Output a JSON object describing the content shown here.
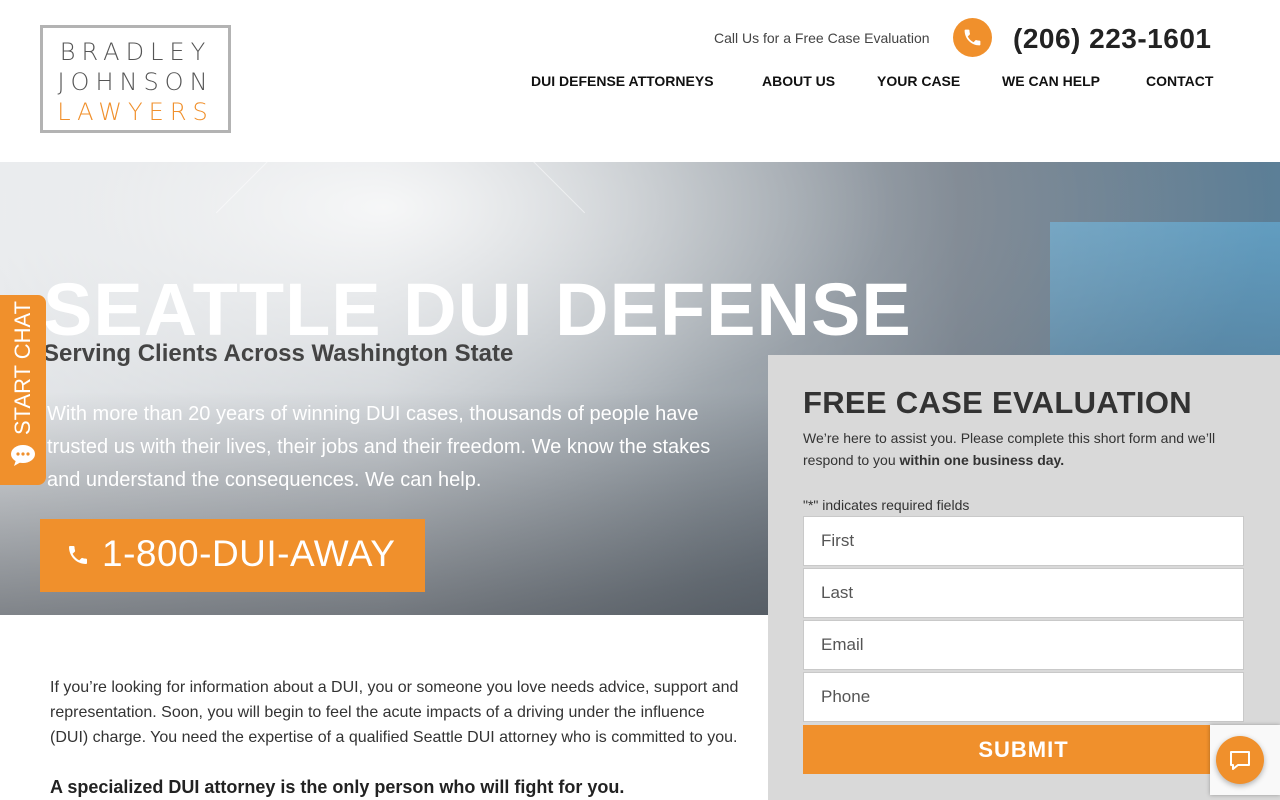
{
  "logo": {
    "line1": "BRADLEY",
    "line2": "JOHNSON",
    "line3": "LAWYERS"
  },
  "header": {
    "call_text": "Call Us for a Free Case Evaluation",
    "phone": "(206) 223-1601",
    "nav": [
      "DUI DEFENSE ATTORNEYS",
      "ABOUT US",
      "YOUR CASE",
      "WE CAN HELP",
      "CONTACT"
    ]
  },
  "hero": {
    "title": "SEATTLE DUI DEFENSE",
    "subtitle": "Serving Clients Across Washington State",
    "body": "With more than 20 years of winning DUI cases, thousands of people have trusted us with their lives, their jobs and their freedom. We know the stakes and understand the consequences. We can help.",
    "cta_label": "1-800-DUI-AWAY"
  },
  "chat_tab": {
    "label": "START CHAT"
  },
  "form": {
    "title": "FREE CASE EVALUATION",
    "desc_plain": "We’re here to assist you. Please complete this short form and we’ll respond to you ",
    "desc_bold": "within one business day.",
    "required_note": "\"*\" indicates required fields",
    "fields": {
      "first": "First",
      "last": "Last",
      "email": "Email",
      "phone": "Phone"
    },
    "submit": "SUBMIT"
  },
  "content": {
    "p1": "If you’re looking for information about a DUI, you or someone you love needs advice, support and representation. Soon, you will begin to feel the acute impacts of a driving under the influence (DUI) charge. You need the expertise of a qualified Seattle DUI attorney who is committed to you.",
    "p2": "A specialized DUI attorney is the only person who will fight for you."
  },
  "colors": {
    "accent": "#f0902c",
    "text": "#222222",
    "panel": "#d9d9d9"
  }
}
